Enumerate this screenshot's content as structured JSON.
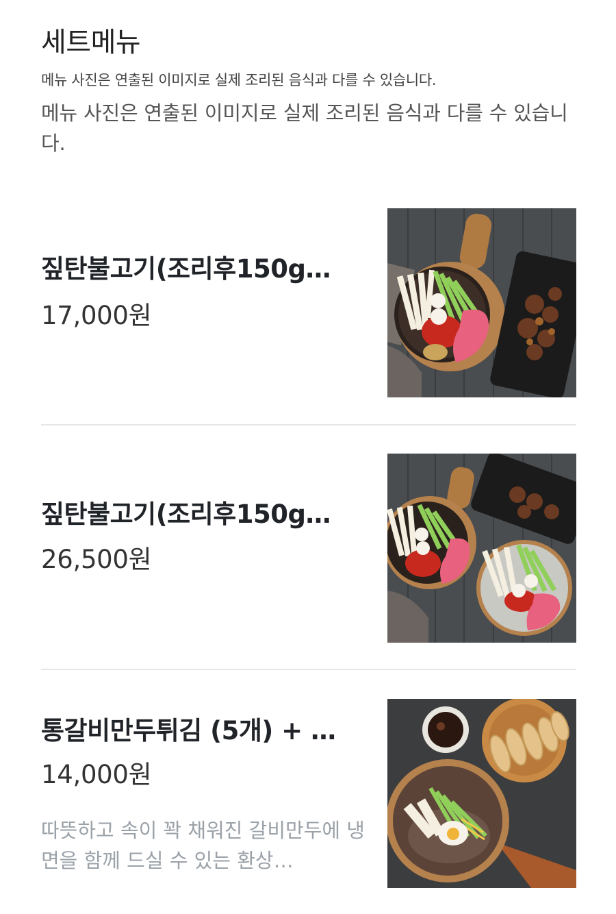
{
  "section": {
    "title": "세트메뉴",
    "notice_small": "메뉴 사진은 연출된 이미지로 실제 조리된 음식과 다를 수 있습니다.",
    "notice_large": "메뉴 사진은 연출된 이미지로 실제 조리된 음식과 다를 수 있습니다."
  },
  "items": [
    {
      "name": "짚탄불고기(조리후150g…",
      "price": "17,000원"
    },
    {
      "name": "짚탄불고기(조리후150g…",
      "price": "26,500원"
    },
    {
      "name": "통갈비만두튀김 (5개) + …",
      "price": "14,000원",
      "description": "따뜻하고 속이 꽉 채워진 갈비만두에 냉면을 함께 드실 수 있는 환상…"
    }
  ],
  "colors": {
    "text_primary": "#202328",
    "text_secondary": "#9aa1a8",
    "divider": "#e6e6e6"
  }
}
